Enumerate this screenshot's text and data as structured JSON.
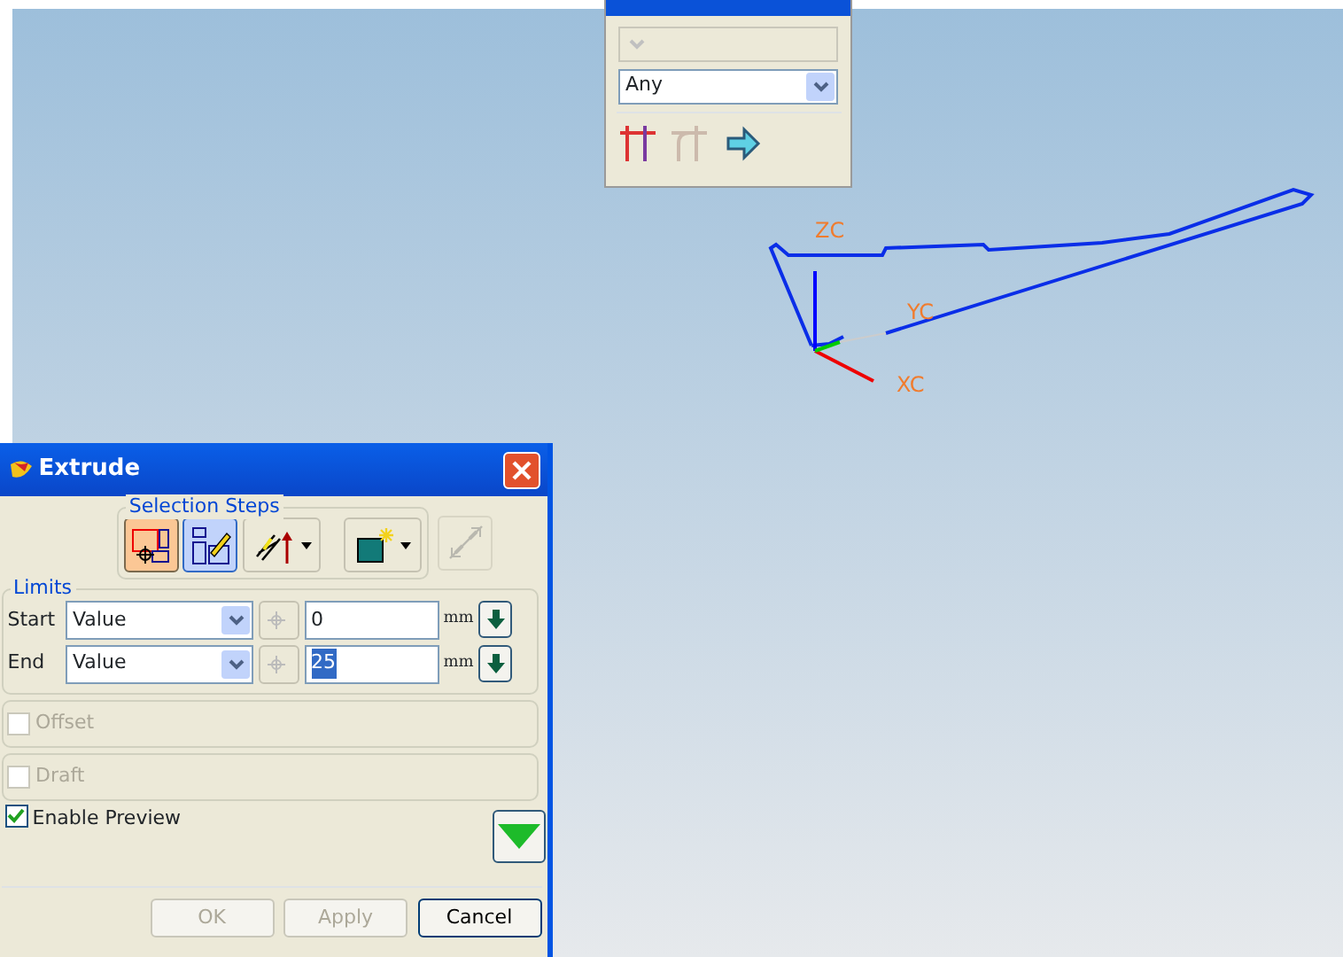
{
  "selection_intent": {
    "dropdowns": [
      {
        "disabled": true
      },
      {
        "value": "Any",
        "disabled": false
      }
    ],
    "tools": [
      {
        "kind": "curves",
        "disabled": false
      },
      {
        "kind": "tangent",
        "disabled": true
      },
      {
        "kind": "arrow",
        "disabled": false
      }
    ]
  },
  "viewport": {
    "axis_labels": [
      {
        "kind": "z",
        "text": "ZC"
      },
      {
        "kind": "y",
        "text": "YC"
      },
      {
        "kind": "x",
        "text": "XC"
      }
    ]
  },
  "extrude": {
    "title": "Extrude",
    "selection_steps": {
      "label": "Selection Steps",
      "steps": [
        {
          "kind": "section",
          "selected": true,
          "disabled": false,
          "menu": false
        },
        {
          "kind": "sketch",
          "selected": false,
          "disabled": false,
          "menu": false
        },
        {
          "kind": "direction",
          "selected": false,
          "disabled": false,
          "menu": true
        },
        {
          "kind": "body",
          "selected": false,
          "disabled": false,
          "menu": true
        },
        {
          "kind": "reverse",
          "selected": false,
          "disabled": true,
          "menu": false
        }
      ]
    },
    "limits": {
      "label": "Limits",
      "rows": [
        {
          "label": "Start",
          "type": "Value",
          "value": "0",
          "unit": "mm",
          "highlighted": false
        },
        {
          "label": "End",
          "type": "Value",
          "value": "25",
          "unit": "mm",
          "highlighted": true
        }
      ]
    },
    "options": [
      {
        "label": "Offset",
        "checked": false,
        "disabled": true
      },
      {
        "label": "Draft",
        "checked": false,
        "disabled": true
      }
    ],
    "preview": {
      "label": "Enable Preview",
      "checked": true
    },
    "buttons": [
      {
        "label": "OK",
        "disabled": true
      },
      {
        "label": "Apply",
        "disabled": true
      },
      {
        "label": "Cancel",
        "disabled": false
      }
    ]
  }
}
